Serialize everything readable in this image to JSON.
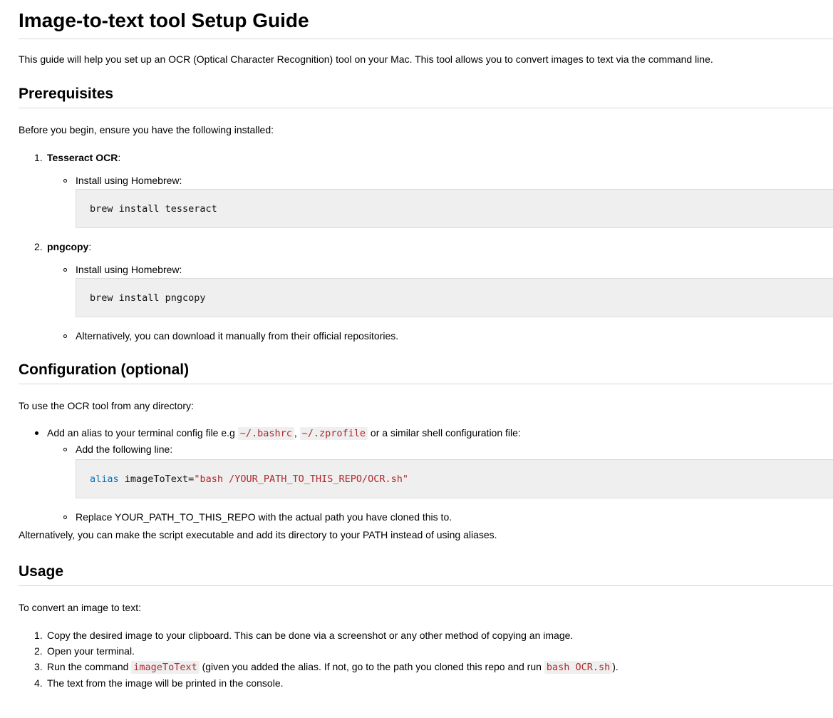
{
  "title": "Image-to-text tool Setup Guide",
  "intro": "This guide will help you set up an OCR (Optical Character Recognition) tool on your Mac. This tool allows you to convert images to text via the command line.",
  "prerequisites": {
    "heading": "Prerequisites",
    "lead": "Before you begin, ensure you have the following installed:",
    "items": [
      {
        "number": "1.",
        "name": "Tesseract OCR",
        "suffix": ":",
        "sub": "Install using Homebrew:",
        "code": "brew install tesseract"
      },
      {
        "number": "2.",
        "name": "pngcopy",
        "suffix": ":",
        "sub": "Install using Homebrew:",
        "code": "brew install pngcopy",
        "alt": "Alternatively, you can download it manually from their official repositories."
      }
    ]
  },
  "configuration": {
    "heading": "Configuration (optional)",
    "lead": "To use the OCR tool from any directory:",
    "bullet_pre": "Add an alias to your terminal config file e.g ",
    "code1": "~/.bashrc",
    "sep": ", ",
    "code2": "~/.zprofile",
    "bullet_post": " or a similar shell configuration file:",
    "sub1": "Add the following line:",
    "alias_kw": "alias",
    "alias_name": " imageToText=",
    "alias_str": "\"bash /YOUR_PATH_TO_THIS_REPO/OCR.sh\"",
    "sub2": "Replace YOUR_PATH_TO_THIS_REPO with the actual path you have cloned this to.",
    "alt": "Alternatively, you can make the script executable and add its directory to your PATH instead of using aliases."
  },
  "usage": {
    "heading": "Usage",
    "lead": "To convert an image to text:",
    "step1_num": "1.",
    "step1": "Copy the desired image to your clipboard. This can be done via a screenshot or any other method of copying an image.",
    "step2_num": "2.",
    "step2": "Open your terminal.",
    "step3_num": "3.",
    "step3_pre": "Run the command ",
    "step3_code1": "imageToText",
    "step3_mid": " (given you added the alias. If not, go to the path you cloned this repo and run ",
    "step3_code2": "bash OCR.sh",
    "step3_post": ").",
    "step4_num": "4.",
    "step4": "The text from the image will be printed in the console."
  }
}
